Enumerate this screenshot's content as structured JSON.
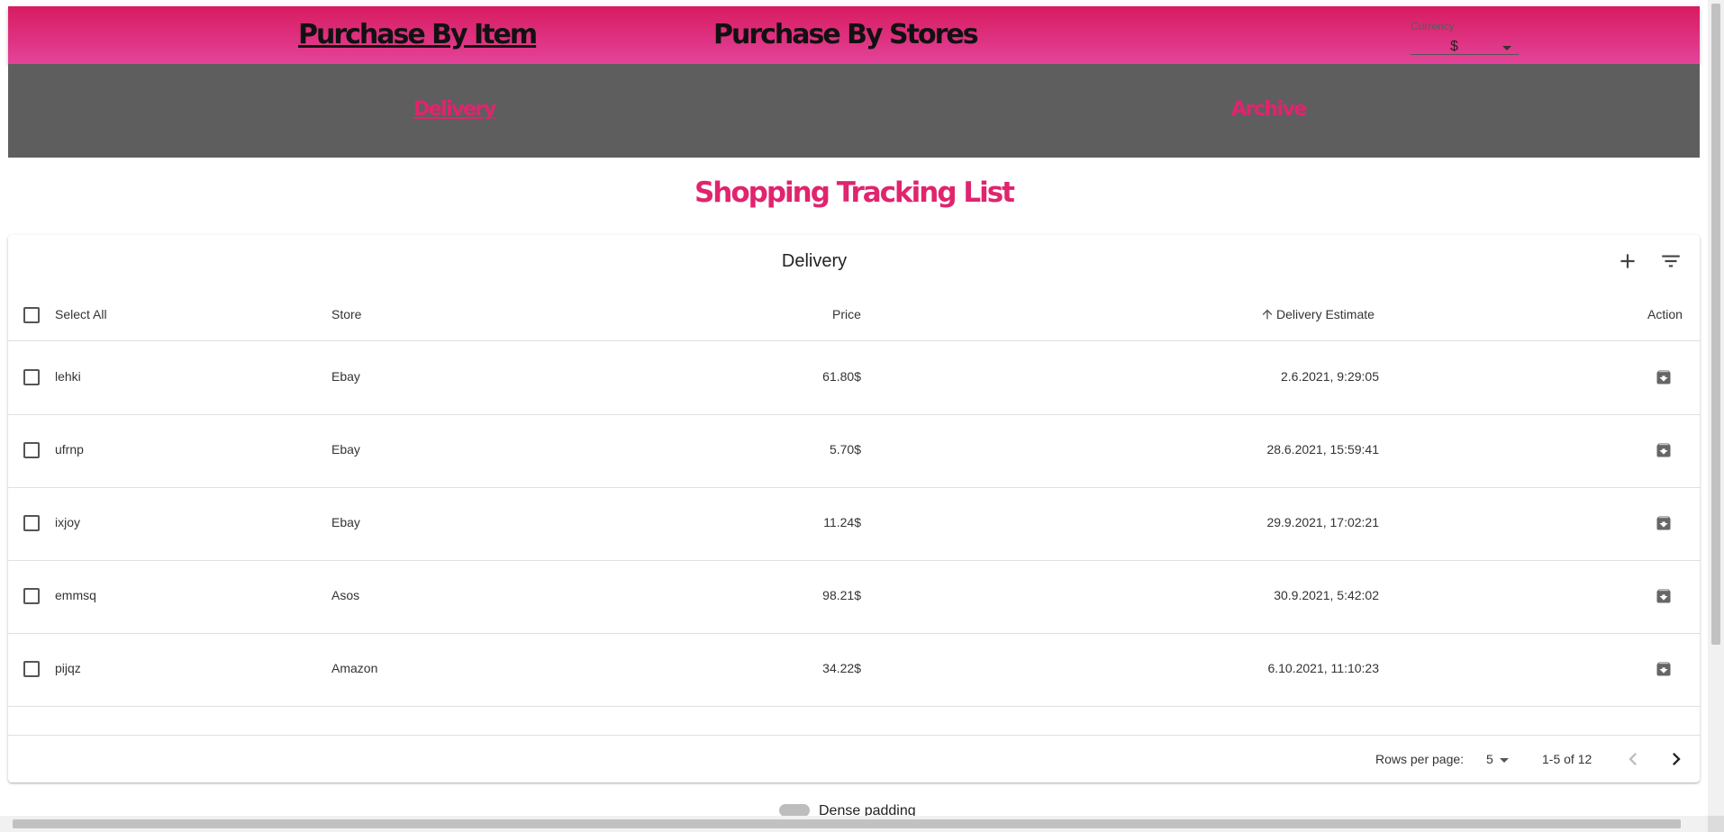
{
  "appbar": {
    "nav": [
      "Purchase By Item",
      "Purchase By Stores"
    ],
    "currency": {
      "label": "Currency",
      "value": "$"
    }
  },
  "tabs": [
    "Delivery",
    "Archive"
  ],
  "page_title": "Shopping Tracking List",
  "table": {
    "title": "Delivery",
    "headers": {
      "select_all": "Select All",
      "store": "Store",
      "price": "Price",
      "delivery": "Delivery Estimate",
      "action": "Action"
    },
    "rows": [
      {
        "name": "lehki",
        "store": "Ebay",
        "price": "61.80$",
        "delivery": "2.6.2021, 9:29:05"
      },
      {
        "name": "ufrnp",
        "store": "Ebay",
        "price": "5.70$",
        "delivery": "28.6.2021, 15:59:41"
      },
      {
        "name": "ixjoy",
        "store": "Ebay",
        "price": "11.24$",
        "delivery": "29.9.2021, 17:02:21"
      },
      {
        "name": "emmsq",
        "store": "Asos",
        "price": "98.21$",
        "delivery": "30.9.2021, 5:42:02"
      },
      {
        "name": "pijqz",
        "store": "Amazon",
        "price": "34.22$",
        "delivery": "6.10.2021, 11:10:23"
      }
    ],
    "footer": {
      "rows_per_page_label": "Rows per page:",
      "rows_per_page": "5",
      "range": "1-5 of 12"
    }
  },
  "dense_toggle_label": "Dense padding",
  "colors": {
    "accent": "#e0246e",
    "appbar_top": "#d81b60",
    "appbar_bottom": "#e3439a",
    "tabbar": "#5e5e5e"
  }
}
